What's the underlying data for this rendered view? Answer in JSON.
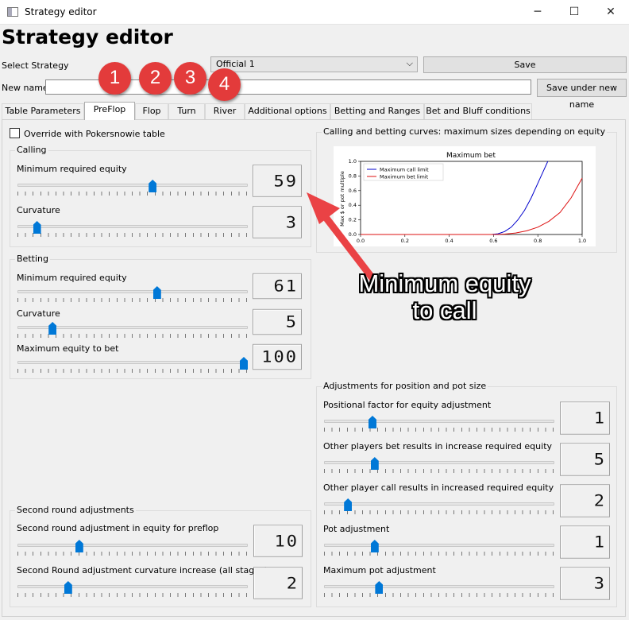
{
  "window": {
    "title": "Strategy editor",
    "minimize": "─",
    "maximize": "☐",
    "close": "✕"
  },
  "heading": "Strategy editor",
  "select_strategy": {
    "label": "Select Strategy",
    "value": "Official 1",
    "save": "Save"
  },
  "new_name": {
    "label": "New name",
    "value": "",
    "save_under": "Save under new name"
  },
  "tabs": [
    "Table Parameters",
    "PreFlop",
    "Flop",
    "Turn",
    "River",
    "Additional options",
    "Betting and Ranges",
    "Bet and Bluff conditions"
  ],
  "override_label": "Override with Pokersnowie table",
  "calling": {
    "title": "Calling",
    "min_equity": {
      "label": "Minimum required equity",
      "value": "59",
      "level": 0.59
    },
    "curvature": {
      "label": "Curvature",
      "value": "3",
      "level": 0.07
    }
  },
  "betting": {
    "title": "Betting",
    "min_equity": {
      "label": "Minimum required equity",
      "value": "61",
      "level": 0.61
    },
    "curvature": {
      "label": "Curvature",
      "value": "5",
      "level": 0.14
    },
    "max_equity": {
      "label": "Maximum equity to bet",
      "value": "100",
      "level": 1.0
    }
  },
  "curves": {
    "title": "Calling and betting curves: maximum sizes depending on equity"
  },
  "chart_data": {
    "type": "line",
    "title": "Maximum bet",
    "xlabel": "",
    "ylabel": "Max $ or pot multiple",
    "xlim": [
      0,
      1
    ],
    "ylim": [
      0,
      1
    ],
    "x_ticks": [
      "0.0",
      "0.2",
      "0.4",
      "0.6",
      "0.8",
      "1.0"
    ],
    "y_ticks": [
      "0.0",
      "0.2",
      "0.4",
      "0.6",
      "0.8",
      "1.0"
    ],
    "legend_position": "top-left",
    "series": [
      {
        "name": "Maximum call limit",
        "color": "#0000cc",
        "x": [
          0,
          0.59,
          0.62,
          0.65,
          0.68,
          0.71,
          0.74,
          0.77,
          0.8,
          0.83,
          0.845
        ],
        "y": [
          0,
          0,
          0.01,
          0.04,
          0.1,
          0.2,
          0.33,
          0.5,
          0.7,
          0.9,
          1.0
        ]
      },
      {
        "name": "Maximum bet limit",
        "color": "#dd1111",
        "x": [
          0,
          0.61,
          0.65,
          0.7,
          0.75,
          0.8,
          0.85,
          0.9,
          0.95,
          1.0
        ],
        "y": [
          0,
          0,
          0.005,
          0.02,
          0.05,
          0.1,
          0.18,
          0.3,
          0.5,
          0.77
        ]
      }
    ]
  },
  "adjustments": {
    "title": "Adjustments for position and pot size",
    "items": [
      {
        "label": "Positional factor for equity adjustment",
        "value": "1",
        "level": 0.2
      },
      {
        "label": "Other players bet results in increase required equity",
        "value": "5",
        "level": 0.21
      },
      {
        "label": "Other player call results in increased required equity",
        "value": "2",
        "level": 0.09
      },
      {
        "label": "Pot adjustment",
        "value": "1",
        "level": 0.21
      },
      {
        "label": "Maximum pot adjustment",
        "value": "3",
        "level": 0.23
      }
    ]
  },
  "second_round": {
    "title": "Second round adjustments",
    "items": [
      {
        "label": "Second round adjustment in equity for preflop",
        "value": "10",
        "level": 0.26
      },
      {
        "label": "Second Round adjustment curvature increase (all stages)",
        "value": "2",
        "level": 0.21
      }
    ]
  },
  "annotations": {
    "badges": [
      "1",
      "2",
      "3",
      "4"
    ],
    "callout": "Minimum equity to call",
    "arrow_color": "#ea4245",
    "badge_color": "#e33b3b"
  }
}
